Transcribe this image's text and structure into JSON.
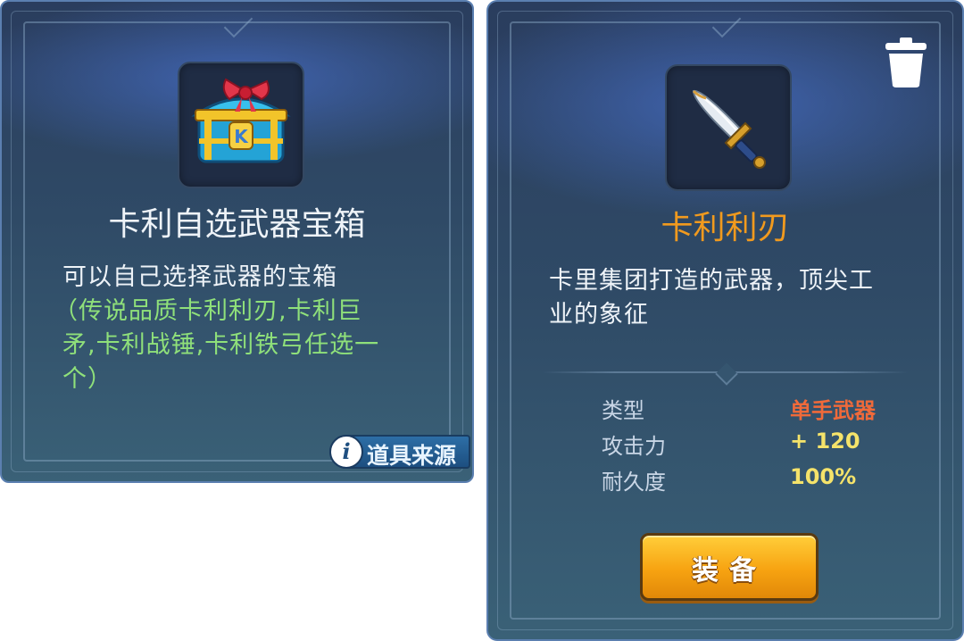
{
  "left_card": {
    "title": "卡利自选武器宝箱",
    "description_line1": "可以自己选择武器的宝箱",
    "options_lines": [
      "（传说品质卡利利刃,卡利巨",
      "矛,卡利战锤,卡利铁弓任选一",
      "个）"
    ],
    "item_icon": "treasure-chest-icon",
    "source_button": {
      "label": "道具来源",
      "icon": "info-icon",
      "icon_glyph": "i"
    }
  },
  "right_card": {
    "title": "卡利利刃",
    "description_lines": [
      "卡里集团打造的武器，顶尖工",
      "业的象征"
    ],
    "item_icon": "sword-icon",
    "delete_icon": "trash-icon",
    "stats": [
      {
        "label": "类型",
        "value": "单手武器",
        "color": "#f06a3a"
      },
      {
        "label": "攻击力",
        "value": "+ 120",
        "color": "#f5e36a"
      },
      {
        "label": "耐久度",
        "value": "100%",
        "color": "#f5e36a"
      }
    ],
    "equip_button": {
      "label": "装备"
    }
  },
  "colors": {
    "title_orange": "#f19a1e",
    "option_green": "#8fe07a",
    "button_orange": "#f7a311"
  }
}
